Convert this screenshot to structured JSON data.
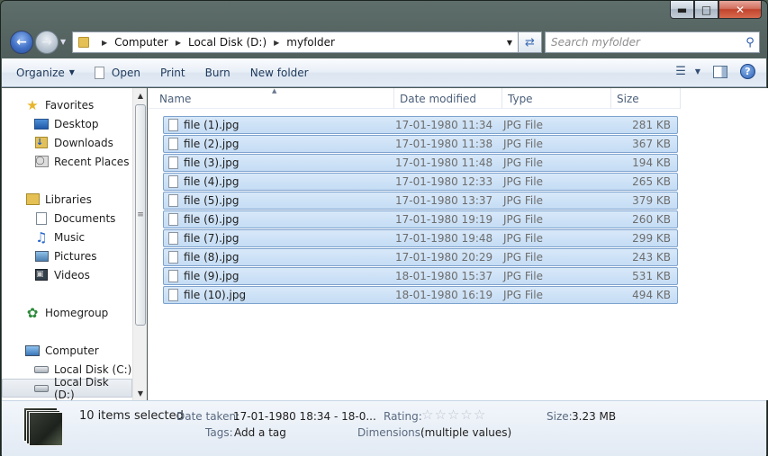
{
  "titlebar": {
    "minimize_icon": "minimize-icon",
    "maximize_icon": "maximize-icon",
    "close_icon": "close-icon"
  },
  "address": {
    "breadcrumbs": [
      "Computer",
      "Local Disk (D:)",
      "myfolder"
    ],
    "search_placeholder": "Search myfolder"
  },
  "commands": {
    "organize": "Organize",
    "open": "Open",
    "print": "Print",
    "burn": "Burn",
    "new_folder": "New folder"
  },
  "nav": {
    "items": [
      {
        "label": "Favorites",
        "icon": "star-icon"
      },
      {
        "label": "Desktop",
        "icon": "desktop-icon"
      },
      {
        "label": "Downloads",
        "icon": "downloads-icon"
      },
      {
        "label": "Recent Places",
        "icon": "recent-places-icon"
      },
      {
        "label": "Libraries",
        "icon": "libraries-icon"
      },
      {
        "label": "Documents",
        "icon": "documents-icon"
      },
      {
        "label": "Music",
        "icon": "music-icon"
      },
      {
        "label": "Pictures",
        "icon": "pictures-icon"
      },
      {
        "label": "Videos",
        "icon": "videos-icon"
      },
      {
        "label": "Homegroup",
        "icon": "homegroup-icon"
      },
      {
        "label": "Computer",
        "icon": "computer-icon"
      },
      {
        "label": "Local Disk (C:)",
        "icon": "drive-icon"
      },
      {
        "label": "Local Disk (D:)",
        "icon": "drive-icon"
      }
    ],
    "selected_label": "Local Disk (D:)"
  },
  "columns": {
    "name": "Name",
    "date": "Date modified",
    "type": "Type",
    "size": "Size"
  },
  "files": [
    {
      "name": "file (1).jpg",
      "date": "17-01-1980 11:34",
      "type": "JPG File",
      "size": "281 KB"
    },
    {
      "name": "file (2).jpg",
      "date": "17-01-1980 11:38",
      "type": "JPG File",
      "size": "367 KB"
    },
    {
      "name": "file (3).jpg",
      "date": "17-01-1980 11:48",
      "type": "JPG File",
      "size": "194 KB"
    },
    {
      "name": "file (4).jpg",
      "date": "17-01-1980 12:33",
      "type": "JPG File",
      "size": "265 KB"
    },
    {
      "name": "file (5).jpg",
      "date": "17-01-1980 13:37",
      "type": "JPG File",
      "size": "379 KB"
    },
    {
      "name": "file (6).jpg",
      "date": "17-01-1980 19:19",
      "type": "JPG File",
      "size": "260 KB"
    },
    {
      "name": "file (7).jpg",
      "date": "17-01-1980 19:48",
      "type": "JPG File",
      "size": "299 KB"
    },
    {
      "name": "file (8).jpg",
      "date": "17-01-1980 20:29",
      "type": "JPG File",
      "size": "243 KB"
    },
    {
      "name": "file (9).jpg",
      "date": "18-01-1980 15:37",
      "type": "JPG File",
      "size": "531 KB"
    },
    {
      "name": "file (10).jpg",
      "date": "18-01-1980 16:19",
      "type": "JPG File",
      "size": "494 KB"
    }
  ],
  "details": {
    "selection": "10 items selected",
    "date_taken_label": "Date taken:",
    "date_taken_value": "17-01-1980 18:34 - 18-0...",
    "tags_label": "Tags:",
    "tags_value": "Add a tag",
    "rating_label": "Rating:",
    "rating_stars": 0,
    "dimensions_label": "Dimensions:",
    "dimensions_value": "(multiple values)",
    "size_label": "Size:",
    "size_value": "3.23 MB"
  }
}
